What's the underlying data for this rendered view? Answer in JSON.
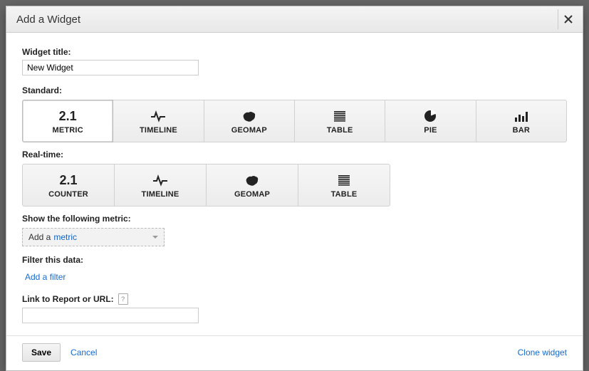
{
  "modal": {
    "title": "Add a Widget"
  },
  "labels": {
    "widget_title": "Widget title:",
    "standard": "Standard:",
    "realtime": "Real-time:",
    "show_metric": "Show the following metric:",
    "filter_data": "Filter this data:",
    "link_report": "Link to Report or URL:"
  },
  "inputs": {
    "widget_title_value": "New Widget",
    "link_value": ""
  },
  "metric_select": {
    "add": "Add a",
    "metric": "metric"
  },
  "actions": {
    "add_filter": "Add a filter",
    "save": "Save",
    "cancel": "Cancel",
    "clone": "Clone widget"
  },
  "standard_tiles": [
    {
      "text_icon": "2.1",
      "label": "METRIC",
      "name": "tile-metric",
      "icon": "text",
      "selected": true
    },
    {
      "label": "TIMELINE",
      "name": "tile-timeline",
      "icon": "pulse"
    },
    {
      "label": "GEOMAP",
      "name": "tile-geomap",
      "icon": "geo"
    },
    {
      "label": "TABLE",
      "name": "tile-table",
      "icon": "table"
    },
    {
      "label": "PIE",
      "name": "tile-pie",
      "icon": "pie"
    },
    {
      "label": "BAR",
      "name": "tile-bar",
      "icon": "bar"
    }
  ],
  "realtime_tiles": [
    {
      "text_icon": "2.1",
      "label": "COUNTER",
      "name": "tile-counter",
      "icon": "text"
    },
    {
      "label": "TIMELINE",
      "name": "tile-rt-timeline",
      "icon": "pulse"
    },
    {
      "label": "GEOMAP",
      "name": "tile-rt-geomap",
      "icon": "geo"
    },
    {
      "label": "TABLE",
      "name": "tile-rt-table",
      "icon": "table"
    }
  ]
}
